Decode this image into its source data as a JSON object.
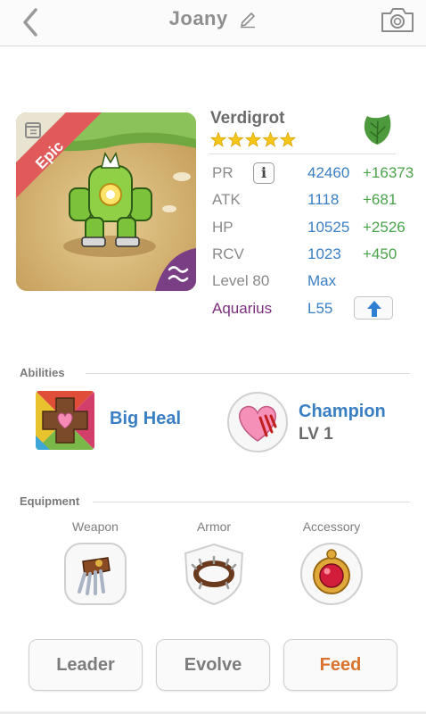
{
  "nav": {
    "title": "Joany",
    "back_icon": "chevron-left-icon",
    "edit_icon": "pencil-icon",
    "camera_icon": "camera-icon"
  },
  "unit": {
    "rarity": "Epic",
    "name": "Verdigrot",
    "stars": 5,
    "element_icon": "leaf-icon",
    "stats": [
      {
        "key": "PR",
        "value": "42460",
        "bonus": "+16373"
      },
      {
        "key": "ATK",
        "value": "1118",
        "bonus": "+681"
      },
      {
        "key": "HP",
        "value": "10525",
        "bonus": "+2526"
      },
      {
        "key": "RCV",
        "value": "1023",
        "bonus": "+450"
      }
    ],
    "level": {
      "label": "Level 80",
      "value": "Max"
    },
    "sign": {
      "label": "Aquarius",
      "value": "L55"
    }
  },
  "abilities": {
    "header": "Abilities",
    "ability_name": "Big Heal",
    "champion_name": "Champion",
    "champion_level": "LV 1"
  },
  "equipment": {
    "header": "Equipment",
    "weapon_label": "Weapon",
    "armor_label": "Armor",
    "accessory_label": "Accessory"
  },
  "buttons": {
    "leader": "Leader",
    "evolve": "Evolve",
    "feed": "Feed"
  },
  "colors": {
    "stat_value": "#3a7fc4",
    "stat_bonus": "#4aa34a",
    "sign_label": "#7b2f7e",
    "feed": "#d9722c",
    "rarity_ribbon": "#e05a5a",
    "element_green": "#4c9a3c"
  }
}
